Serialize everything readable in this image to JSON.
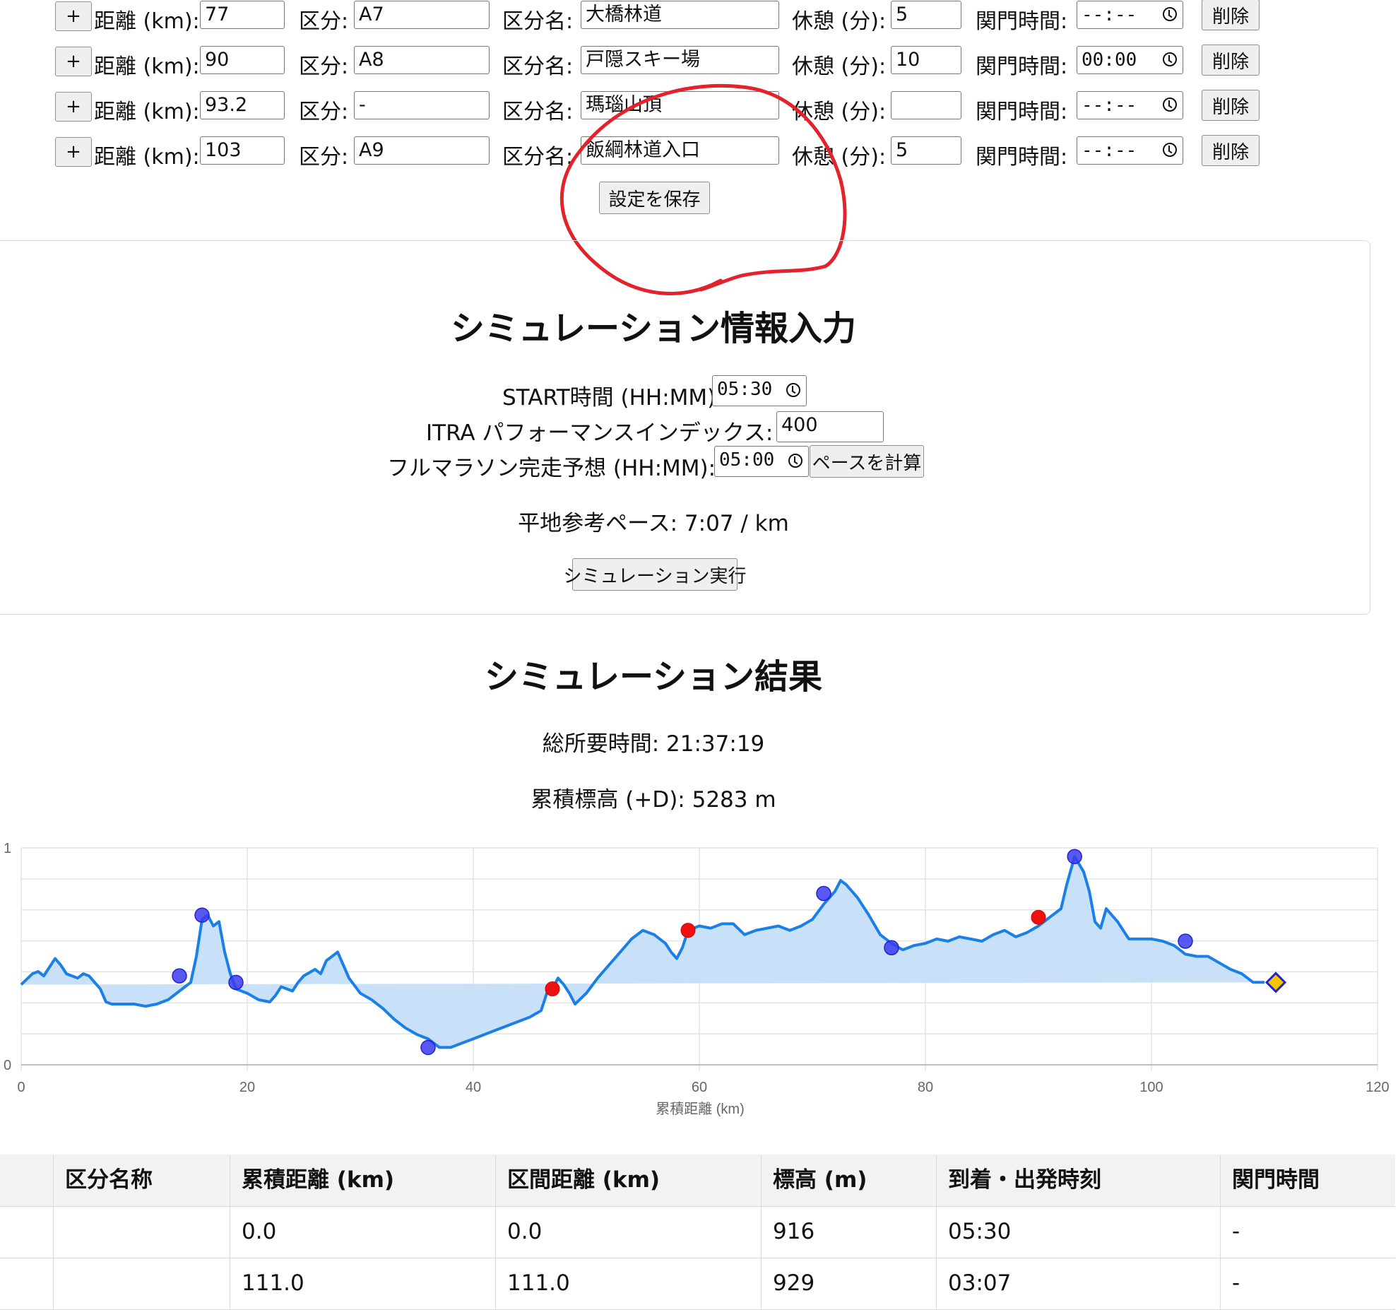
{
  "checkpoints": [
    {
      "add": "+",
      "distance_label": "距離 (km):",
      "distance": "77",
      "section_label": "区分:",
      "section": "A7",
      "name_label": "区分名:",
      "name": "大橋林道",
      "rest_label": "休憩 (分):",
      "rest": "5",
      "cutoff_label": "関門時間:",
      "cutoff": "--:--",
      "delete": "削除"
    },
    {
      "add": "+",
      "distance_label": "距離 (km):",
      "distance": "90",
      "section_label": "区分:",
      "section": "A8",
      "name_label": "区分名:",
      "name": "戸隠スキー場",
      "rest_label": "休憩 (分):",
      "rest": "10",
      "cutoff_label": "関門時間:",
      "cutoff": "00:00",
      "delete": "削除"
    },
    {
      "add": "+",
      "distance_label": "距離 (km):",
      "distance": "93.2",
      "section_label": "区分:",
      "section": "-",
      "name_label": "区分名:",
      "name": "瑪瑙山頂",
      "rest_label": "休憩 (分):",
      "rest": "",
      "cutoff_label": "関門時間:",
      "cutoff": "--:--",
      "delete": "削除"
    },
    {
      "add": "+",
      "distance_label": "距離 (km):",
      "distance": "103",
      "section_label": "区分:",
      "section": "A9",
      "name_label": "区分名:",
      "name": "飯綱林道入口",
      "rest_label": "休憩 (分):",
      "rest": "5",
      "cutoff_label": "関門時間:",
      "cutoff": "--:--",
      "delete": "削除"
    }
  ],
  "save_button": "設定を保存",
  "sim_input": {
    "title": "シミュレーション情報入力",
    "start_label": "START時間 (HH:MM):",
    "start_value": "05:30",
    "itra_label": "ITRA パフォーマンスインデックス:",
    "itra_value": "400",
    "marathon_label": "フルマラソン完走予想 (HH:MM):",
    "marathon_value": "05:00",
    "calc_button": "ペースを計算",
    "pace_text": "平地参考ペース: 7:07 / km",
    "run_button": "シミュレーション実行"
  },
  "results": {
    "title": "シミュレーション結果",
    "total_time": "総所要時間: 21:37:19",
    "elevation_gain": "累積標高 (+D): 5283 m"
  },
  "chart_data": {
    "type": "area",
    "xlabel": "累積距離 (km)",
    "ylabel": "",
    "xlim": [
      0,
      120
    ],
    "ylim": [
      0,
      1
    ],
    "x_ticks": [
      "0",
      "20",
      "40",
      "60",
      "80",
      "100",
      "120"
    ],
    "y_ticks": [
      "0",
      "1"
    ],
    "grid": true,
    "line_color": "#1a7fe6",
    "fill_color": "#c8e1f8",
    "profile": {
      "x": [
        0,
        1,
        1.5,
        2,
        2.5,
        3,
        3.5,
        4,
        5,
        5.5,
        6,
        7,
        7.5,
        8,
        9,
        10,
        11,
        12,
        13,
        14,
        14.5,
        15,
        15.5,
        16,
        16.5,
        17,
        17.5,
        18,
        18.5,
        19,
        20,
        21,
        22,
        22.5,
        23,
        24,
        24.5,
        25,
        26,
        26.5,
        27,
        28,
        29,
        30,
        31,
        32,
        33,
        34,
        35,
        36,
        37,
        38,
        39,
        40,
        41,
        42,
        43,
        44,
        45,
        46,
        46.5,
        47,
        47.5,
        48,
        48.5,
        49,
        50,
        51,
        52,
        53,
        54,
        55,
        56,
        57,
        57.5,
        58,
        58.5,
        59,
        60,
        61,
        62,
        63,
        64,
        65,
        66,
        67,
        68,
        69,
        70,
        71,
        72,
        72.5,
        73,
        74,
        75,
        76,
        77,
        78,
        79,
        80,
        81,
        82,
        83,
        84,
        85,
        86,
        87,
        88,
        89,
        90,
        91,
        92,
        92.5,
        93.2,
        94,
        94.5,
        95,
        95.5,
        96,
        97,
        97.5,
        98,
        99,
        100,
        101,
        102,
        103,
        104,
        105,
        106,
        107,
        108,
        109,
        110,
        111
      ],
      "y": [
        0.37,
        0.42,
        0.43,
        0.41,
        0.45,
        0.49,
        0.46,
        0.42,
        0.4,
        0.42,
        0.41,
        0.35,
        0.29,
        0.28,
        0.28,
        0.28,
        0.27,
        0.28,
        0.3,
        0.34,
        0.36,
        0.38,
        0.5,
        0.67,
        0.69,
        0.64,
        0.66,
        0.52,
        0.42,
        0.35,
        0.33,
        0.3,
        0.29,
        0.32,
        0.36,
        0.34,
        0.38,
        0.41,
        0.44,
        0.42,
        0.48,
        0.52,
        0.4,
        0.33,
        0.3,
        0.26,
        0.21,
        0.17,
        0.14,
        0.12,
        0.08,
        0.08,
        0.1,
        0.12,
        0.14,
        0.16,
        0.18,
        0.2,
        0.22,
        0.25,
        0.33,
        0.35,
        0.4,
        0.37,
        0.33,
        0.28,
        0.33,
        0.4,
        0.46,
        0.52,
        0.58,
        0.62,
        0.6,
        0.56,
        0.52,
        0.49,
        0.54,
        0.62,
        0.64,
        0.63,
        0.65,
        0.65,
        0.6,
        0.62,
        0.63,
        0.64,
        0.62,
        0.64,
        0.67,
        0.74,
        0.8,
        0.85,
        0.83,
        0.77,
        0.69,
        0.6,
        0.56,
        0.53,
        0.55,
        0.56,
        0.58,
        0.57,
        0.59,
        0.58,
        0.57,
        0.6,
        0.62,
        0.59,
        0.61,
        0.64,
        0.68,
        0.72,
        0.83,
        0.96,
        0.89,
        0.8,
        0.66,
        0.63,
        0.72,
        0.66,
        0.62,
        0.58,
        0.58,
        0.58,
        0.57,
        0.55,
        0.51,
        0.5,
        0.5,
        0.47,
        0.44,
        0.42,
        0.38,
        0.38
      ]
    },
    "checkpoints_blue": {
      "x": [
        14,
        16,
        19,
        36,
        71,
        77,
        93.2,
        103
      ],
      "y": [
        0.41,
        0.69,
        0.38,
        0.08,
        0.79,
        0.54,
        0.96,
        0.57
      ]
    },
    "checkpoints_red": {
      "x": [
        47,
        59,
        90
      ],
      "y": [
        0.35,
        0.62,
        0.68
      ]
    },
    "finish_marker": {
      "x": 111,
      "y": 0.38,
      "color": "#f5c400"
    }
  },
  "table": {
    "headers": [
      "",
      "区分名称",
      "累積距離 (km)",
      "区間距離 (km)",
      "標高 (m)",
      "到着・出発時刻",
      "関門時間"
    ],
    "rows": [
      [
        "",
        "",
        "0.0",
        "0.0",
        "916",
        "05:30",
        "-"
      ],
      [
        "",
        "",
        "111.0",
        "111.0",
        "929",
        "03:07",
        "-"
      ]
    ]
  }
}
